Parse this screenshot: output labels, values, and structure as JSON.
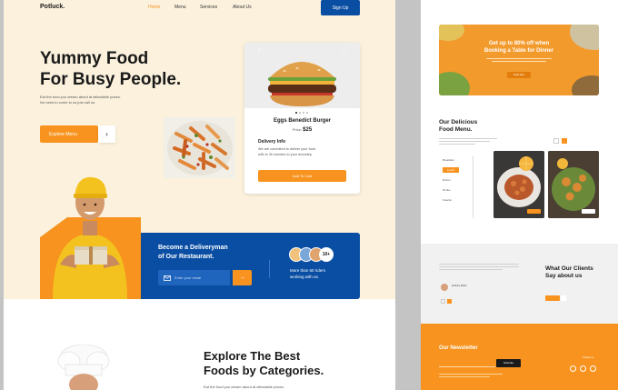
{
  "colors": {
    "accent": "#f7931e",
    "primary": "#0a4ea3",
    "cream": "#fbf1dd"
  },
  "header": {
    "logo": "Potluck.",
    "nav": [
      "Home",
      "Menu",
      "Services",
      "About Us"
    ],
    "signup": "Sign Up"
  },
  "hero": {
    "title_line1": "Yummy Food",
    "title_line2": "For Busy People.",
    "desc_line1": "Eat the food you dream about at affordable prices.",
    "desc_line2": "No need to come to us just call us.",
    "cta": "Explore Menu",
    "cta_arrow": "›"
  },
  "product_card": {
    "prev": "‹",
    "like": "♡",
    "name": "Eggs Benedict Burger",
    "price_label": "Price:",
    "price": "$25",
    "delivery_title": "Delivery Info",
    "delivery_line1": "We are commited to deliver your food",
    "delivery_line2": "with in 30 minutes to your doorstep.",
    "add": "Add To Cart"
  },
  "delivery": {
    "title_line1": "Become a Deliveryman",
    "title_line2": "of Our Restaurant.",
    "email_placeholder": "Enter your email",
    "submit_arrow": "→",
    "count_badge": "10+",
    "riders_line1": "More than 50 riders",
    "riders_line2": "working with us."
  },
  "categories": {
    "title_line1": "Explore The Best",
    "title_line2": "Foods by Categories.",
    "desc": "Eat the food you dream about at affordable prices."
  },
  "right_promo": {
    "title_line1": "Get up to 80% off when",
    "title_line2": "Booking a Table for Dinner",
    "btn": "Book Now"
  },
  "right_menu": {
    "title_line1": "Our Delicious",
    "title_line2": "Food Menu.",
    "categories": [
      "Breakfast",
      "Lunch",
      "Dinner",
      "Drinks",
      "Snacks"
    ]
  },
  "right_reviews": {
    "title_line1": "What Our Clients",
    "title_line2": "Say about us",
    "reviewer": "Anthony Robin"
  },
  "right_newsletter": {
    "title": "Our Newsletter",
    "subscribe": "Subscribe",
    "follow": "Follow us"
  }
}
